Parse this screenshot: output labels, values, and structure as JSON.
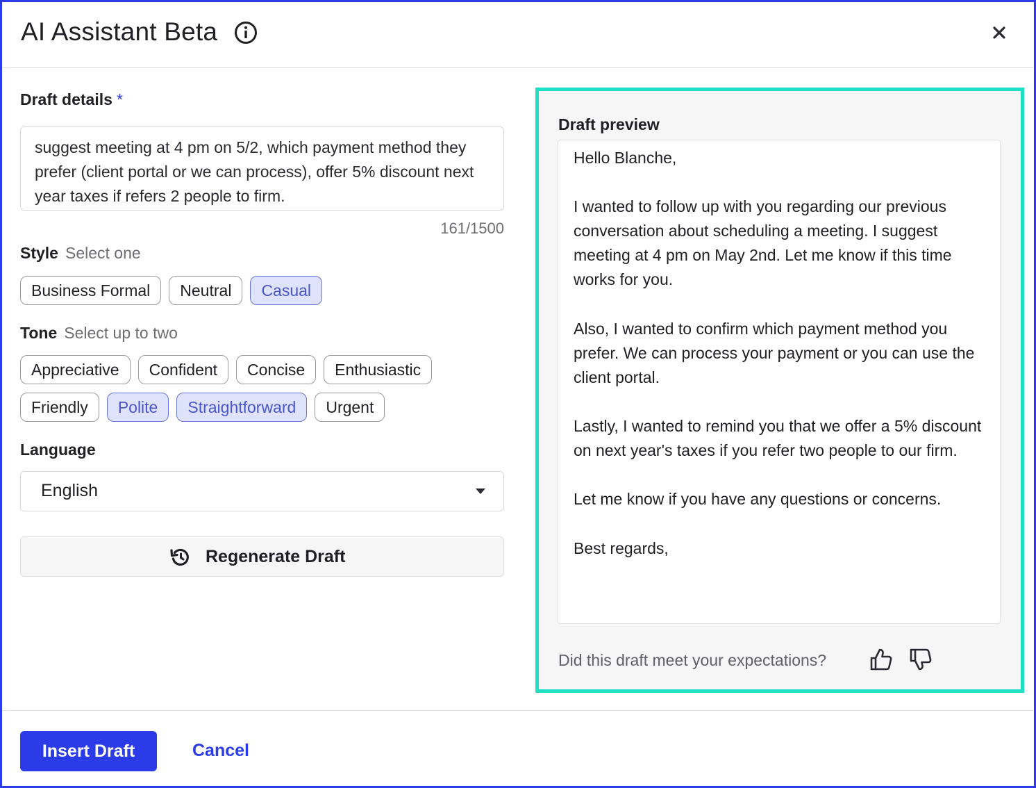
{
  "header": {
    "title": "AI Assistant Beta",
    "info_icon": "info-circle-icon",
    "close_icon": "close-icon"
  },
  "draft_details": {
    "label": "Draft details",
    "required_marker": "*",
    "value": "suggest meeting at 4 pm on 5/2, which payment method they prefer (client portal or we can process), offer 5% discount next year taxes if refers 2 people to firm.",
    "counter": "161/1500"
  },
  "style": {
    "label": "Style",
    "hint": "Select one",
    "options": [
      {
        "label": "Business Formal",
        "selected": false
      },
      {
        "label": "Neutral",
        "selected": false
      },
      {
        "label": "Casual",
        "selected": true
      }
    ]
  },
  "tone": {
    "label": "Tone",
    "hint": "Select up to two",
    "options": [
      {
        "label": "Appreciative",
        "selected": false
      },
      {
        "label": "Confident",
        "selected": false
      },
      {
        "label": "Concise",
        "selected": false
      },
      {
        "label": "Enthusiastic",
        "selected": false
      },
      {
        "label": "Friendly",
        "selected": false
      },
      {
        "label": "Polite",
        "selected": true
      },
      {
        "label": "Straightforward",
        "selected": true
      },
      {
        "label": "Urgent",
        "selected": false
      }
    ]
  },
  "language": {
    "label": "Language",
    "value": "English"
  },
  "regenerate": {
    "label": "Regenerate Draft",
    "icon": "refresh-icon"
  },
  "preview": {
    "label": "Draft preview",
    "greeting": "Hello Blanche,",
    "paragraph1": "I wanted to follow up with you regarding our previous conversation about scheduling a meeting. I suggest meeting at 4 pm on May 2nd. Let me know if this time works for you.",
    "paragraph2": "Also, I wanted to confirm which payment method you prefer. We can process your payment or you can use the client portal.",
    "paragraph3": "Lastly, I wanted to remind you that we offer a 5% discount on next year's taxes if you refer two people to our firm.",
    "paragraph4": "Let me know if you have any questions or concerns.",
    "closing": "Best regards,",
    "feedback_question": "Did this draft meet your expectations?",
    "thumbs_up_icon": "thumbs-up-icon",
    "thumbs_down_icon": "thumbs-down-icon",
    "highlight_color": "#1fe0c3"
  },
  "footer": {
    "insert_label": "Insert Draft",
    "cancel_label": "Cancel"
  },
  "colors": {
    "accent": "#2b3be8",
    "chip_selected_bg": "#dfe2fb",
    "chip_selected_text": "#4a55c9"
  }
}
